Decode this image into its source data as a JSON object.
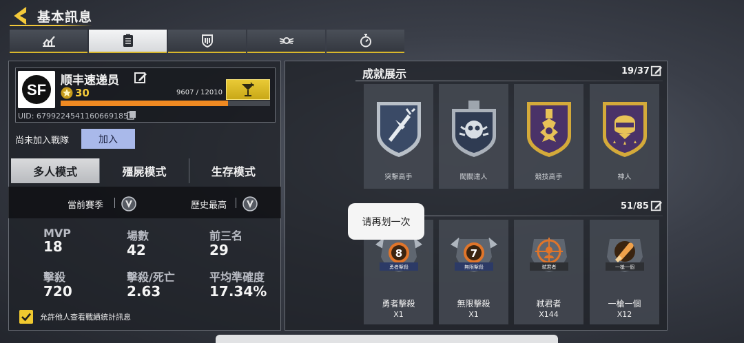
{
  "header": {
    "title": "基本訊息"
  },
  "tabs": [
    {
      "icon": "stats-chart-icon",
      "active": false
    },
    {
      "icon": "clipboard-icon",
      "active": true
    },
    {
      "icon": "shield-emblem-icon",
      "active": false
    },
    {
      "icon": "wings-emblem-icon",
      "active": false
    },
    {
      "icon": "stopwatch-icon",
      "active": false
    }
  ],
  "profile": {
    "name": "顺丰速递员",
    "level": "30",
    "xp_text": "9607 / 12010",
    "xp_fraction": 0.8,
    "uid": "UID: 6799224541160669185",
    "clan_label": "尚未加入戰隊",
    "join_label": "加入"
  },
  "modes": [
    "多人模式",
    "殭屍模式",
    "生存模式"
  ],
  "season": {
    "current": "當前賽季",
    "best": "歷史最高"
  },
  "stats": [
    {
      "label": "MVP",
      "value": "18"
    },
    {
      "label": "場數",
      "value": "42"
    },
    {
      "label": "前三名",
      "value": "29"
    },
    {
      "label": "擊殺",
      "value": "720"
    },
    {
      "label": "擊殺/死亡",
      "value": "2.63"
    },
    {
      "label": "平均準確度",
      "value": "17.34%"
    }
  ],
  "allow_text": "允許他人查看戰績統計訊息",
  "achievements": {
    "title": "成就展示",
    "count": "19/37",
    "items": [
      {
        "name": "突擊高手",
        "color": "#3a4a66"
      },
      {
        "name": "闖關達人",
        "color": "#2f3b52"
      },
      {
        "name": "競技高手",
        "color": "#4a3268"
      },
      {
        "name": "神人",
        "color": "#4a3268"
      }
    ]
  },
  "medals": {
    "count": "51/85",
    "items": [
      {
        "name": "勇者擊殺",
        "tag": "勇者擊殺",
        "count": "X1"
      },
      {
        "name": "無限擊殺",
        "tag": "無限擊殺",
        "count": "X1"
      },
      {
        "name": "弒君者",
        "tag": "弒君者",
        "count": "X144"
      },
      {
        "name": "一槍一個",
        "tag": "一槍一個",
        "count": "X12"
      }
    ]
  },
  "toast": "请再划一次",
  "colors": {
    "accent": "#f3c93a",
    "xp": "#f08a22",
    "join": "#a9b9ea"
  }
}
